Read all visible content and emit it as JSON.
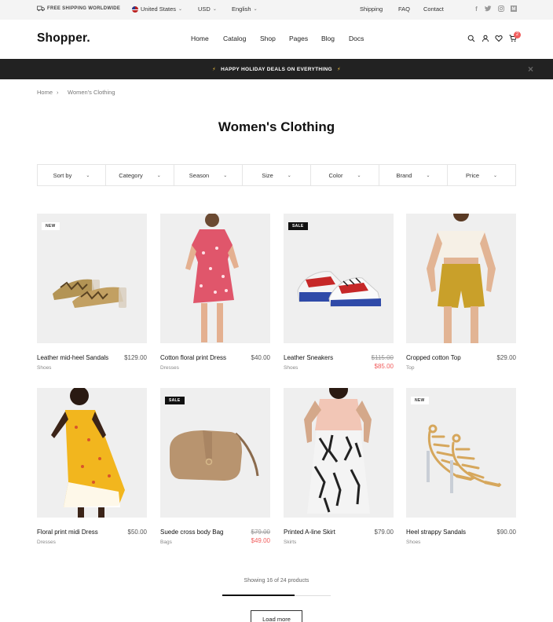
{
  "topbar": {
    "shipping_note": "FREE SHIPPING WORLDWIDE",
    "country": "United States",
    "currency": "USD",
    "language": "English",
    "links": [
      "Shipping",
      "FAQ",
      "Contact"
    ],
    "social_icons": [
      "facebook-icon",
      "twitter-icon",
      "instagram-icon",
      "medium-icon"
    ]
  },
  "header": {
    "logo": "Shopper.",
    "nav": [
      "Home",
      "Catalog",
      "Shop",
      "Pages",
      "Blog",
      "Docs"
    ],
    "cart_count": "2",
    "icons": [
      "search-icon",
      "user-icon",
      "heart-icon",
      "cart-icon"
    ]
  },
  "promo": {
    "text": "HAPPY HOLIDAY DEALS ON EVERYTHING",
    "bolt": "⚡"
  },
  "breadcrumb": [
    "Home",
    "Women's Clothing"
  ],
  "page_title": "Women's Clothing",
  "filters": [
    "Sort by",
    "Category",
    "Season",
    "Size",
    "Color",
    "Brand",
    "Price"
  ],
  "products": [
    {
      "name": "Leather mid-heel Sandals",
      "category": "Shoes",
      "price": "$129.00",
      "badge": "NEW"
    },
    {
      "name": "Cotton floral print Dress",
      "category": "Dresses",
      "price": "$40.00"
    },
    {
      "name": "Leather Sneakers",
      "category": "Shoes",
      "old_price": "$115.00",
      "sale_price": "$85.00",
      "badge": "SALE"
    },
    {
      "name": "Cropped cotton Top",
      "category": "Top",
      "price": "$29.00"
    },
    {
      "name": "Floral print midi Dress",
      "category": "Dresses",
      "price": "$50.00"
    },
    {
      "name": "Suede cross body Bag",
      "category": "Bags",
      "old_price": "$79.00",
      "sale_price": "$49.00",
      "badge": "SALE"
    },
    {
      "name": "Printed A-line Skirt",
      "category": "Skirts",
      "price": "$79.00"
    },
    {
      "name": "Heel strappy Sandals",
      "category": "Shoes",
      "price": "$90.00",
      "badge": "NEW"
    }
  ],
  "pagination": {
    "showing_text": "Showing 16 of 24 products",
    "progress_fraction": 0.667,
    "load_more": "Load more"
  },
  "colors": {
    "accent_red": "#f15e5e",
    "promo_bg": "#222222",
    "topbar_bg": "#f4f4f4"
  }
}
